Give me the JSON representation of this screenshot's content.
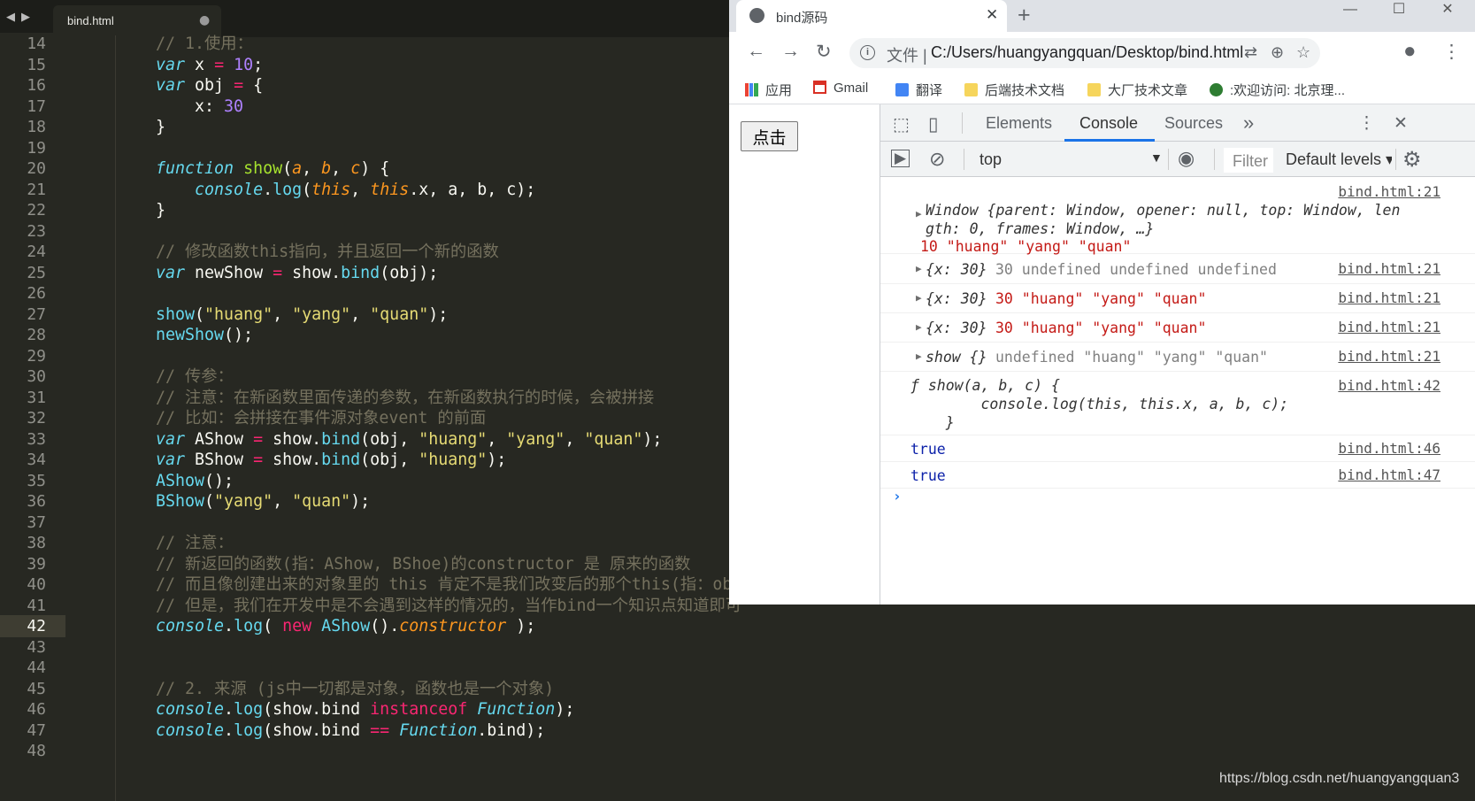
{
  "editor": {
    "tab_name": "bind.html",
    "dirty_marker": "●",
    "back_arrow": "◀",
    "forward_arrow": "▶",
    "current_line": 42,
    "line_numbers": [
      "14",
      "15",
      "16",
      "17",
      "18",
      "19",
      "20",
      "21",
      "22",
      "23",
      "24",
      "25",
      "26",
      "27",
      "28",
      "29",
      "30",
      "31",
      "32",
      "33",
      "34",
      "35",
      "36",
      "37",
      "38",
      "39",
      "40",
      "41",
      "42",
      "43",
      "44",
      "45",
      "46",
      "47",
      "48"
    ],
    "code_lines": [
      "// 1.使用：",
      "var x = 10;",
      "var obj = {",
      "    x: 30",
      "}",
      "",
      "function show(a, b, c) {",
      "    console.log(this, this.x, a, b, c);",
      "}",
      "",
      "// 修改函数this指向，并且返回一个新的函数",
      "var newShow = show.bind(obj);",
      "",
      "show(\"huang\", \"yang\", \"quan\");",
      "newShow();",
      "",
      "// 传参：",
      "// 注意：在新函数里面传递的参数，在新函数执行的时候，会被拼接",
      "// 比如：会拼接在事件源对象event 的前面",
      "var AShow = show.bind(obj, \"huang\", \"yang\", \"quan\");",
      "var BShow = show.bind(obj, \"huang\");",
      "AShow();",
      "BShow(\"yang\", \"quan\");",
      "",
      "// 注意：",
      "// 新返回的函数(指：AShow, BShoe)的constructor 是 原来的函数",
      "// 而且像创建出来的对象里的 this 肯定不是我们改变后的那个this(指：obj)",
      "// 但是，我们在开发中是不会遇到这样的情况的，当作bind一个知识点知道即可",
      "console.log( new AShow().constructor );",
      "",
      "",
      "// 2. 来源 (js中一切都是对象，函数也是一个对象)",
      "console.log(show.bind instanceof Function);",
      "console.log(show.bind == Function.bind);",
      ""
    ]
  },
  "watermark": "https://blog.csdn.net/huangyangquan3",
  "browser": {
    "tab_title": "bind源码",
    "tab_close": "✕",
    "new_tab": "+",
    "win_min": "—",
    "win_max": "☐",
    "win_close": "✕",
    "nav_back": "←",
    "nav_forward": "→",
    "nav_reload": "↻",
    "address_label": "文件 |",
    "address_url": "C:/Users/huangyangquan/Desktop/bind.html",
    "address_info_glyph": "i",
    "translate_glyph": "⇄",
    "zoom_glyph": "⊕",
    "star_glyph": "☆",
    "account_glyph": "●",
    "menu_glyph": "⋮",
    "bookmarks": [
      "应用",
      "Gmail",
      "翻译",
      "后端技术文档",
      "大厂技术文章",
      ":欢迎访问: 北京理..."
    ],
    "page_button": "点击",
    "devtools": {
      "inspect_glyph": "⬚",
      "device_glyph": "▯",
      "tabs": [
        "Elements",
        "Console",
        "Sources"
      ],
      "more_tabs": "»",
      "active_tab": "Console",
      "kebab_glyph": "⋮",
      "close_glyph": "✕",
      "sidebar_glyph": "▶",
      "clear_glyph": "⊘",
      "context": "top",
      "context_arrow": "▼",
      "eye_glyph": "◉",
      "filter_placeholder": "Filter",
      "levels": "Default levels ▾",
      "gear_glyph": "⚙",
      "prompt": "›",
      "messages": [
        {
          "source": "bind.html:21",
          "line1": "Window {parent: Window, opener: null, top: Window, len",
          "line2": "gth: 0, frames: Window, …}",
          "line3": "10 \"huang\" \"yang\" \"quan\""
        },
        {
          "source": "bind.html:21",
          "obj": "{x: 30}",
          "rest": "30 undefined undefined undefined"
        },
        {
          "source": "bind.html:21",
          "obj": "{x: 30}",
          "rest": "30 \"huang\" \"yang\" \"quan\""
        },
        {
          "source": "bind.html:21",
          "obj": "{x: 30}",
          "rest": "30 \"huang\" \"yang\" \"quan\""
        },
        {
          "source": "bind.html:21",
          "obj": "show {}",
          "rest": "undefined \"huang\" \"yang\" \"quan\""
        },
        {
          "source": "bind.html:42",
          "line1": "ƒ show(a, b, c) {",
          "line2": "        console.log(this, this.x, a, b, c);",
          "line3": "    }"
        },
        {
          "source": "bind.html:46",
          "text": "true"
        },
        {
          "source": "bind.html:47",
          "text": "true"
        }
      ]
    }
  },
  "colors": {
    "editor_bg": "#272822",
    "keyword": "#66d9ef",
    "function": "#a6e22e",
    "number": "#ae81ff",
    "string": "#e6db74",
    "comment": "#75715e",
    "operator": "#f92672",
    "param": "#fd971f",
    "devtools_accent": "#1a73e8"
  }
}
